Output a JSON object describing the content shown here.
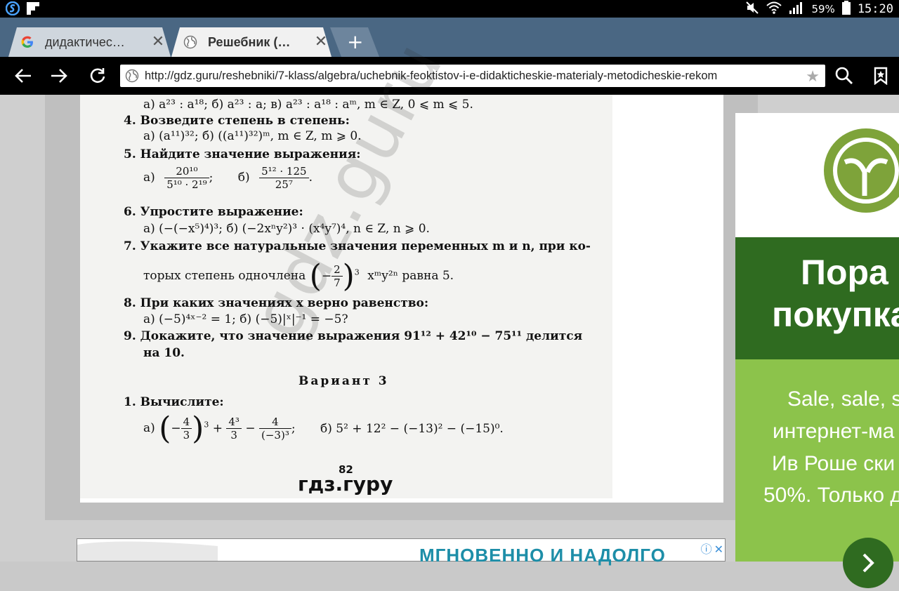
{
  "status_bar": {
    "battery": "59%",
    "time": "15:20"
  },
  "tabs": [
    {
      "title": "дидактичес…",
      "icon": "google-icon"
    },
    {
      "title": "Решебник (…",
      "icon": "globe-icon"
    }
  ],
  "new_tab_label": "+",
  "address_bar": {
    "url": "http://gdz.guru/reshebniki/7-klass/algebra/uchebnik-feoktistov-i-e-didakticheskie-materialy-metodicheskie-rekom"
  },
  "scan": {
    "row_a": "а) a²³ : a¹⁸;      б) a²³ : a;      в) a²³ : a¹⁸ : aᵐ, m ∈ Z, 0 ⩽ m ⩽ 5.",
    "q4_title": "4. Возведите степень в степень:",
    "q4_body": "а) (a¹¹)³²;      б) ((a¹¹)³²)ᵐ, m ∈ Z, m ⩾ 0.",
    "q5_title": "5. Найдите значение выражения:",
    "q5_a_label": "а)",
    "q5_a_num": "20¹⁰",
    "q5_a_den": "5¹⁰ · 2¹⁹",
    "q5_sep": ";",
    "q5_b_label": "б)",
    "q5_b_num": "5¹² · 125",
    "q5_b_den": "25⁷",
    "q5_end": ".",
    "q6_title": "6. Упростите выражение:",
    "q6_body": "а) (−(−x⁵)⁴)³;      б) (−2xⁿy²)³ · (x⁴y⁷)⁴, n ∈ Z, n ⩾ 0.",
    "q7_title": "7. Укажите все натуральные значения переменных m и n, при ко-",
    "q7_line2_pre": "торых степень одночлена",
    "q7_frac_num": "2",
    "q7_frac_den": "7",
    "q7_line2_post": "xᵐy²ⁿ  равна 5.",
    "q8_title": "8. При каких значениях x верно равенство:",
    "q8_body": "а) (−5)⁴ˣ⁻² = 1;     б) (−5)|ˣ|⁻¹ = −5?",
    "q9_title": "9. Докажите, что значение выражения 91¹² + 42¹⁰ − 75¹¹ делится",
    "q9_line2": "на 10.",
    "variant": "Вариант 3",
    "v3_q1_title": "1. Вычислите:",
    "v3_q1_a_label": "а)",
    "v3_frac1_num": "4",
    "v3_frac1_den": "3",
    "v3_frac2_num": "4³",
    "v3_frac2_den": "3",
    "v3_frac3_num": "4",
    "v3_frac3_den": "(−3)³",
    "v3_q1_b": "б) 5² + 12² − (−13)² − (−15)⁰.",
    "page_number": "82",
    "footer_logo": "гдз.гуру",
    "watermark": "gdz.guru"
  },
  "ad_right": {
    "headline_1": "Пора",
    "headline_2": "покупка",
    "line_1": "Sale, sale, s",
    "line_2": "интернет-ма",
    "line_3": "Ив Роше ски",
    "line_4": "50%. Только д"
  },
  "ad_bottom": {
    "text": "МГНОВЕННО И НАДОЛГО"
  }
}
